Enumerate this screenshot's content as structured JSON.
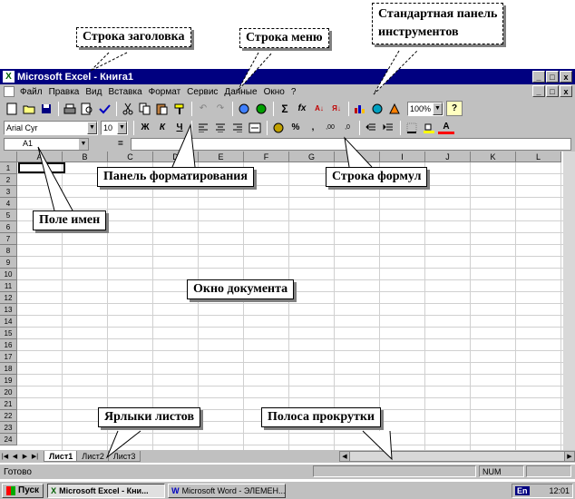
{
  "callouts": {
    "title_row": "Строка заголовка",
    "menu_row": "Строка меню",
    "standard_toolbar": "Стандартная панель\nинструментов",
    "format_panel": "Панель форматирования",
    "formula_row": "Строка формул",
    "name_field": "Поле имен",
    "doc_window": "Окно документа",
    "sheet_tabs": "Ярлыки листов",
    "scrollbar": "Полоса прокрутки"
  },
  "window": {
    "title": "Microsoft Excel - Книга1",
    "app_icon": "X",
    "buttons": [
      "_",
      "□",
      "x"
    ]
  },
  "menu": {
    "items": [
      "Файл",
      "Правка",
      "Вид",
      "Вставка",
      "Формат",
      "Сервис",
      "Данные",
      "Окно",
      "?"
    ]
  },
  "standard_toolbar": {
    "zoom": "100%",
    "sum": "Σ",
    "fx": "fx"
  },
  "format_toolbar": {
    "font": "Arial Cyr",
    "size": "10",
    "bold": "Ж",
    "italic": "К",
    "underline": "Ч",
    "percent": "%",
    "comma": ","
  },
  "formula_bar": {
    "cell_ref": "A1",
    "equals": "="
  },
  "grid": {
    "columns": [
      "A",
      "B",
      "C",
      "D",
      "E",
      "F",
      "G",
      "H",
      "I",
      "J",
      "K",
      "L"
    ],
    "rows": [
      "1",
      "2",
      "3",
      "4",
      "5",
      "6",
      "7",
      "8",
      "9",
      "10",
      "11",
      "12",
      "13",
      "14",
      "15",
      "16",
      "17",
      "18",
      "19",
      "20",
      "21",
      "22",
      "23",
      "24"
    ]
  },
  "sheets": {
    "tabs": [
      "Лист1",
      "Лист2",
      "Лист3"
    ]
  },
  "status": {
    "text": "Готово",
    "num": "NUM"
  },
  "taskbar": {
    "start": "Пуск",
    "items": [
      "Microsoft Excel - Кни...",
      "Microsoft Word - ЭЛЕМЕН..."
    ],
    "lang": "En",
    "time": "12:01"
  }
}
